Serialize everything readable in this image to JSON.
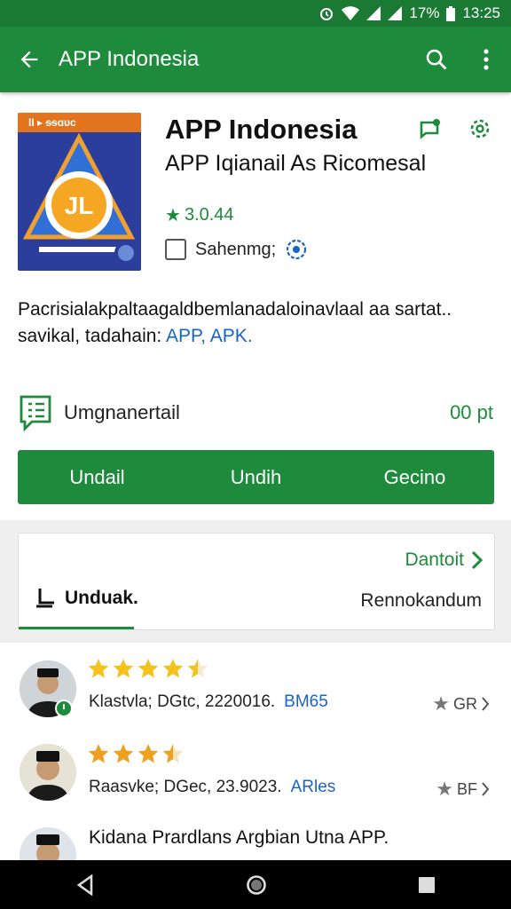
{
  "status": {
    "battery": "17%",
    "time": "13:25"
  },
  "appbar": {
    "title": "APP Indonesia"
  },
  "app": {
    "band_text": "II ▸ ᵴᵴɑᴜᴄ",
    "icon_text": "JL",
    "name": "APP Indonesia",
    "developer": "APP Iqianail As Ricomesal",
    "rating": "3.0.44",
    "checkbox_label": "Sahenmg;"
  },
  "description": {
    "line1": "Pacrisialakpaltaagaldbemlanadaloinavlaal aa sartat..",
    "line2_text": "savikal, tadahain:",
    "line2_link": "APP, APK."
  },
  "install": {
    "label": "Umgnanertail",
    "size": "00 pt"
  },
  "buttons": [
    "Undail",
    "Undih",
    "Gecino"
  ],
  "card": {
    "more_label": "Dantoit",
    "download_label": "Unduak.",
    "recommend_label": "Rennokandum"
  },
  "reviews": [
    {
      "stars": 4.5,
      "meta": "Klastvla; DGtc, 2220016.",
      "tag": "BM65",
      "count": "GR"
    },
    {
      "stars": 3.5,
      "meta": "Raasvke; DGec, 23.9023.",
      "tag": "ARles",
      "count": "BF"
    },
    {
      "stars": 0,
      "meta": "Kidana Prardlans Argbian Utna APP.",
      "tag": "",
      "count": ""
    }
  ],
  "colors": {
    "primary": "#1e8a3c",
    "statusbar": "#1a7a34",
    "link": "#1a64c8",
    "star": "#f4c21b"
  }
}
